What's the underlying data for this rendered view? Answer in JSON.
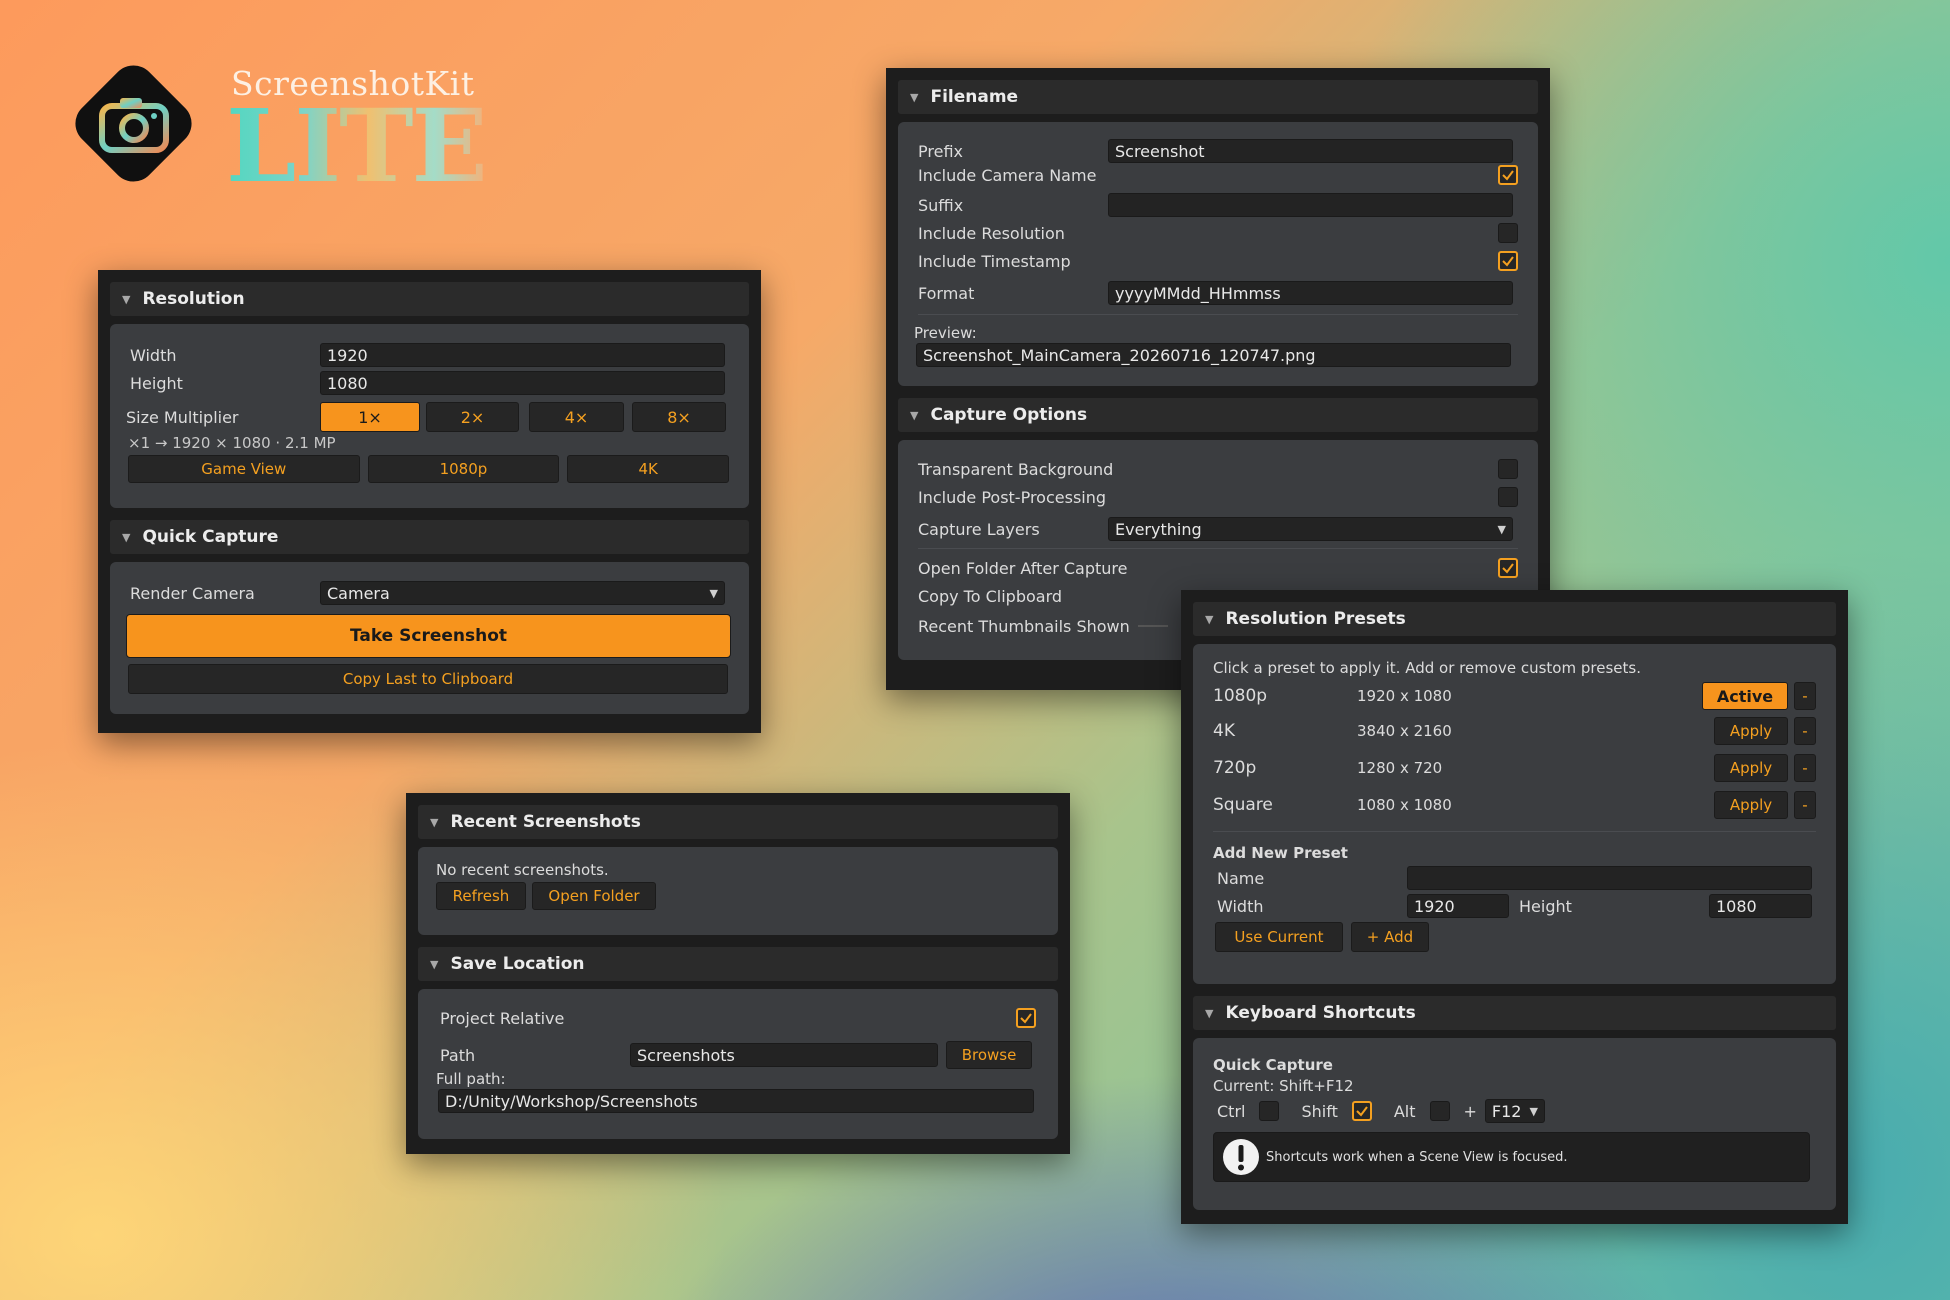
{
  "brand": {
    "name": "ScreenshotKit",
    "edition": "LITE"
  },
  "resolution": {
    "title": "Resolution",
    "width_label": "Width",
    "width_value": "1920",
    "height_label": "Height",
    "height_value": "1080",
    "multiplier_label": "Size Multiplier",
    "multipliers": [
      "1×",
      "2×",
      "4×",
      "8×"
    ],
    "selected_multiplier": "1×",
    "summary": "×1  →  1920 × 1080 · 2.1 MP",
    "presets": [
      "Game View",
      "1080p",
      "4K"
    ]
  },
  "quick_capture": {
    "title": "Quick Capture",
    "camera_label": "Render Camera",
    "camera_value": "Camera",
    "take_label": "Take Screenshot",
    "copy_label": "Copy Last to Clipboard"
  },
  "filename": {
    "title": "Filename",
    "prefix_label": "Prefix",
    "prefix_value": "Screenshot",
    "include_camera_label": "Include Camera Name",
    "include_camera": true,
    "suffix_label": "Suffix",
    "suffix_value": "",
    "include_resolution_label": "Include Resolution",
    "include_resolution": false,
    "include_timestamp_label": "Include Timestamp",
    "include_timestamp": true,
    "format_label": "Format",
    "format_value": "yyyyMMdd_HHmmss",
    "preview_label": "Preview:",
    "preview_value": "Screenshot_MainCamera_20260716_120747.png"
  },
  "capture_options": {
    "title": "Capture Options",
    "transparent_label": "Transparent Background",
    "transparent": false,
    "postprocess_label": "Include Post-Processing",
    "postprocess": false,
    "layers_label": "Capture Layers",
    "layers_value": "Everything",
    "open_folder_label": "Open Folder After Capture",
    "open_folder": true,
    "clipboard_label": "Copy To Clipboard",
    "thumbs_label": "Recent Thumbnails Shown"
  },
  "resolution_presets": {
    "title": "Resolution Presets",
    "hint": "Click a preset to apply it. Add or remove custom presets.",
    "items": [
      {
        "name": "1080p",
        "size": "1920 x 1080",
        "action": "Active",
        "remove": "-"
      },
      {
        "name": "4K",
        "size": "3840 x 2160",
        "action": "Apply",
        "remove": "-"
      },
      {
        "name": "720p",
        "size": "1280 x 720",
        "action": "Apply",
        "remove": "-"
      },
      {
        "name": "Square",
        "size": "1080 x 1080",
        "action": "Apply",
        "remove": "-"
      }
    ],
    "add_title": "Add New Preset",
    "name_label": "Name",
    "name_value": "",
    "width_label": "Width",
    "width_value": "1920",
    "height_label": "Height",
    "height_value": "1080",
    "use_current_label": "Use Current",
    "add_label": "+ Add"
  },
  "keyboard_shortcuts": {
    "title": "Keyboard Shortcuts",
    "subtitle": "Quick Capture",
    "current": "Current: Shift+F12",
    "ctrl_label": "Ctrl",
    "ctrl": false,
    "shift_label": "Shift",
    "shift": true,
    "alt_label": "Alt",
    "alt": false,
    "plus": "+",
    "key_value": "F12",
    "info": "Shortcuts work when a Scene View is focused."
  },
  "recent_screenshots": {
    "title": "Recent Screenshots",
    "empty_text": "No recent screenshots.",
    "refresh_label": "Refresh",
    "open_folder_label": "Open Folder"
  },
  "save_location": {
    "title": "Save Location",
    "project_relative_label": "Project Relative",
    "project_relative": true,
    "path_label": "Path",
    "path_value": "Screenshots",
    "browse_label": "Browse",
    "full_path_label": "Full path:",
    "full_path_value": "D:/Unity/Workshop/Screenshots"
  },
  "colors": {
    "accent": "#f7941d",
    "panel": "#3b3d40",
    "window": "#1d1d1d"
  }
}
